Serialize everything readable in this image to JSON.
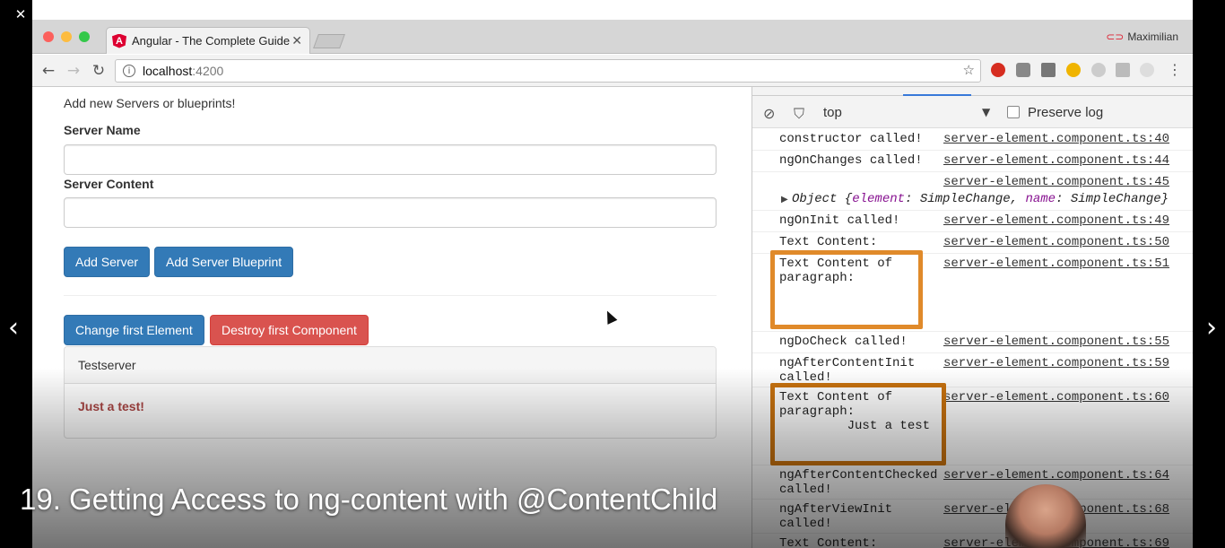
{
  "player": {
    "close_glyph": "✕",
    "restore_glyph": "❐",
    "minimize_glyph": "—",
    "prev_glyph": "‹",
    "next_glyph": "›",
    "caption": "19. Getting Access to ng-content with @ContentChild"
  },
  "browser": {
    "tab_title": "Angular - The Complete Guide",
    "tab_favicon_letter": "A",
    "tab_close_glyph": "✕",
    "profile_name": "Maximilian",
    "url_host": "localhost",
    "url_port": ":4200",
    "info_glyph": "i",
    "star_glyph": "☆",
    "back_glyph": "←",
    "forward_glyph": "→",
    "reload_glyph": "↻",
    "menu_glyph": "⋮",
    "colors": {
      "close": "#fc605c",
      "minimize": "#fdbc40",
      "maximize": "#34c84a"
    }
  },
  "page": {
    "intro": "Add new Servers or blueprints!",
    "server_name_label": "Server Name",
    "server_content_label": "Server Content",
    "add_server": "Add Server",
    "add_blueprint": "Add Server Blueprint",
    "change_first": "Change first Element",
    "destroy_first": "Destroy first Component",
    "panel_heading": "Testserver",
    "panel_body": "Just a test!"
  },
  "devtools": {
    "clear_glyph": "⃠",
    "filter_glyph": "⛉",
    "context": "top",
    "context_caret": "▼",
    "preserve_log": "Preserve log",
    "console": [
      {
        "msg": "constructor called!",
        "src": "server-element.component.ts:40"
      },
      {
        "msg": "ngOnChanges called!",
        "src": "server-element.component.ts:44"
      },
      {
        "msg": "",
        "src": "server-element.component.ts:45"
      },
      {
        "msg": "ngOnInit called!",
        "src": "server-element.component.ts:49"
      },
      {
        "msg": "Text Content:",
        "src": "server-element.component.ts:50"
      },
      {
        "msg": "Text Content of\nparagraph:",
        "src": "server-element.component.ts:51"
      },
      {
        "msg": "ngDoCheck called!",
        "src": "server-element.component.ts:55"
      },
      {
        "msg": "ngAfterContentInit\ncalled!",
        "src": "server-element.component.ts:59"
      },
      {
        "msg": "Text Content of\nparagraph:\n         Just a test",
        "src": "server-element.component.ts:60"
      },
      {
        "msg": "ngAfterContentChecked\ncalled!",
        "src": "server-element.component.ts:64"
      },
      {
        "msg": "ngAfterViewInit\ncalled!",
        "src": "server-element.component.ts:68"
      },
      {
        "msg": "Text Content:",
        "src": "server-element.component.ts:69"
      }
    ],
    "object_line": {
      "triangle": "▶",
      "prefix": "Object {",
      "k1": "element",
      "v1": ": SimpleChange, ",
      "k2": "name",
      "v2": ": SimpleChange}"
    }
  }
}
